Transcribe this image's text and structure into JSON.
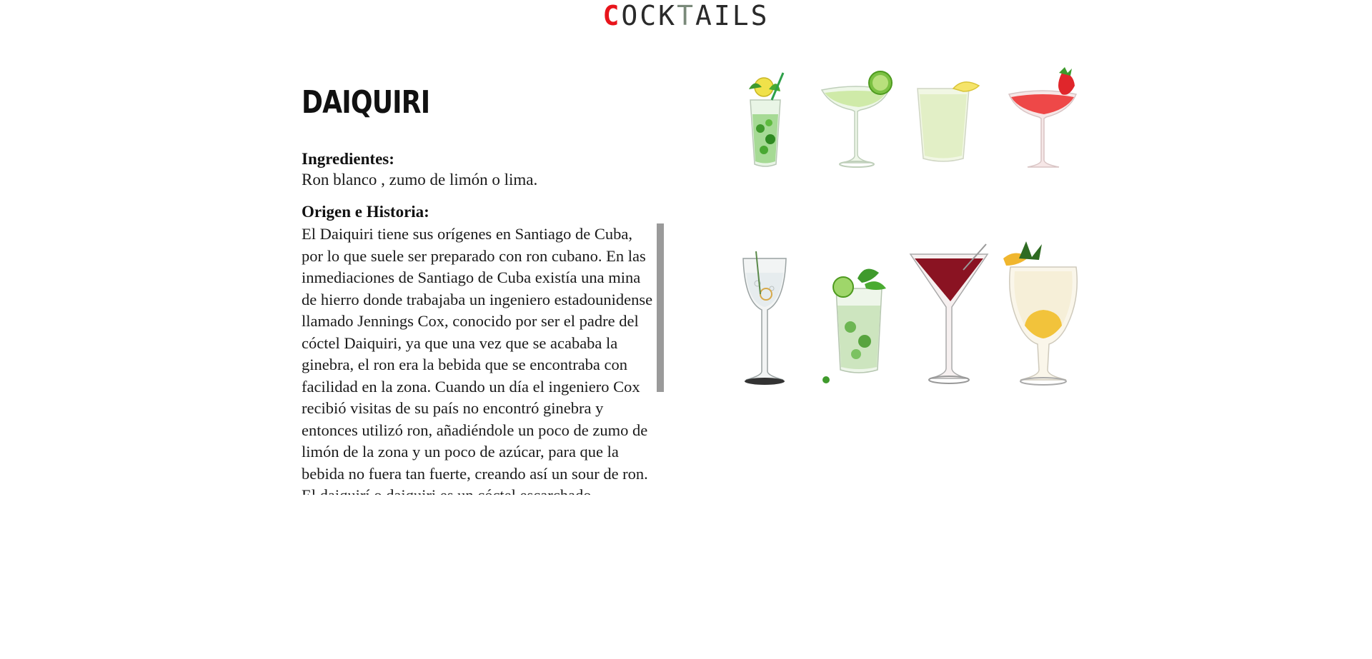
{
  "header": {
    "logo_first": "C",
    "logo_mid": "OCK",
    "logo_t": "T",
    "logo_rest": "AILS"
  },
  "cocktail": {
    "name": "DAIQUIRI",
    "ingredients_label": "Ingredientes:",
    "ingredients": "Ron blanco , zumo de limón o lima.",
    "history_label": "Origen e Historia:",
    "history": "El Daiquiri tiene sus orígenes en Santiago de Cuba, por lo que suele ser preparado con ron cubano. En las inmediaciones de Santiago de Cuba existía una mina de hierro donde trabajaba un ingeniero estadounidense llamado Jennings Cox, conocido por ser el padre del cóctel Daiquiri, ya que una vez que se acababa la ginebra, el ron era la bebida que se encontraba con facilidad en la zona. Cuando un día el ingeniero Cox recibió visitas de su país no encontró ginebra y entonces utilizó ron, añadiéndole un poco de zumo de limón de la zona y un poco de azúcar, para que la bebida no fuera tan fuerte, creando así un sour de ron. El daiquirí o daiquiri es un cóctel escarchado"
  },
  "gallery": {
    "drinks": [
      {
        "icon": "mojito-glass-icon"
      },
      {
        "icon": "margarita-lime-glass-icon"
      },
      {
        "icon": "frozen-daiquiri-glass-icon"
      },
      {
        "icon": "strawberry-margarita-glass-icon"
      },
      {
        "icon": "gin-tonic-glass-icon"
      },
      {
        "icon": "caipirinha-glass-icon"
      },
      {
        "icon": "cosmopolitan-martini-glass-icon"
      },
      {
        "icon": "pina-colada-glass-icon"
      }
    ]
  },
  "colors": {
    "accent": "#e8141b",
    "scrollbar": "#9a9a9a"
  }
}
